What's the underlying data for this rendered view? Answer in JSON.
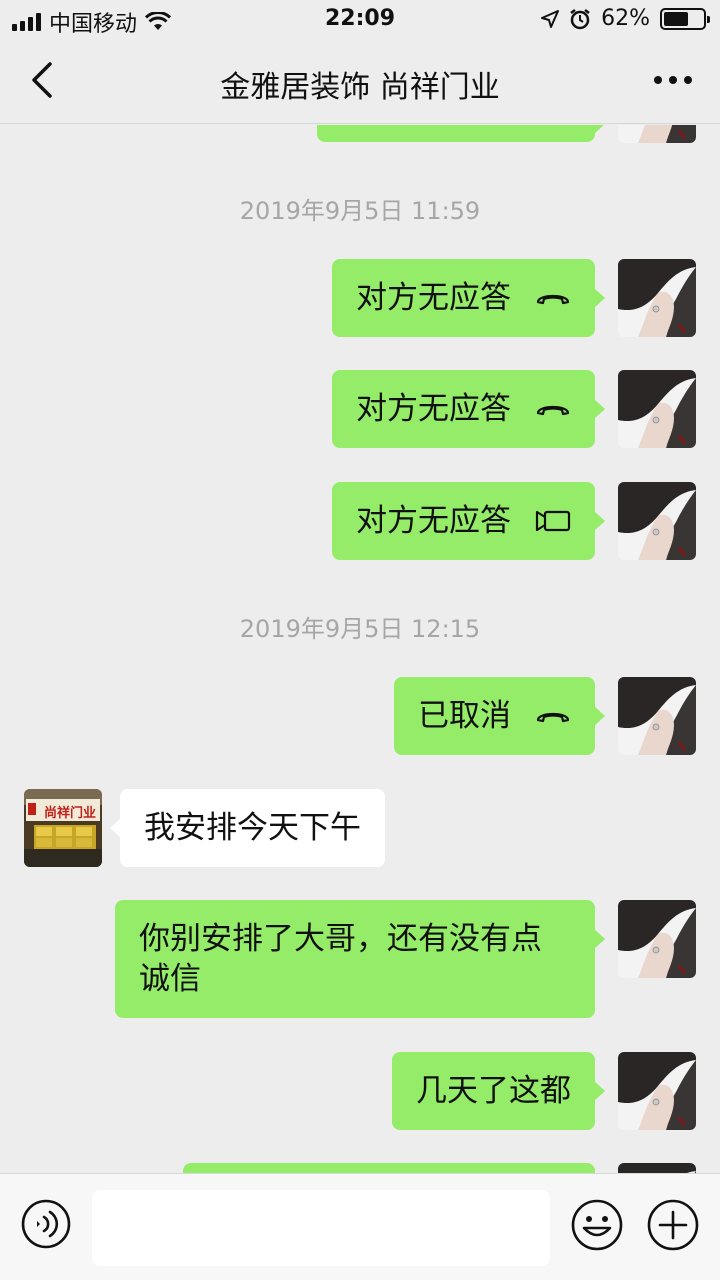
{
  "status_bar": {
    "carrier": "中国移动",
    "time": "22:09",
    "battery": "62%",
    "battery_level": 0.62,
    "icons": [
      "signal-icon",
      "wifi-icon",
      "location-icon",
      "alarm-icon",
      "battery-icon"
    ]
  },
  "header": {
    "title": "金雅居装饰  尚祥门业",
    "back_icon": "chevron-left-icon",
    "more_icon": "more-icon"
  },
  "messages": [
    {
      "type": "bubble-edge",
      "side": "mine"
    },
    {
      "type": "time",
      "text": "2019年9月5日 11:59"
    },
    {
      "type": "call",
      "side": "mine",
      "text": "对方无应答",
      "icon": "phone-hangup-icon"
    },
    {
      "type": "call",
      "side": "mine",
      "text": "对方无应答",
      "icon": "phone-hangup-icon"
    },
    {
      "type": "call",
      "side": "mine",
      "text": "对方无应答",
      "icon": "video-call-icon"
    },
    {
      "type": "time",
      "text": "2019年9月5日 12:15"
    },
    {
      "type": "call",
      "side": "mine",
      "text": "已取消",
      "icon": "phone-hangup-icon"
    },
    {
      "type": "text",
      "side": "theirs",
      "text": "我安排今天下午"
    },
    {
      "type": "text",
      "side": "mine",
      "text": "你别安排了大哥，还有没有点诚信"
    },
    {
      "type": "text",
      "side": "mine",
      "text": "几天了这都"
    }
  ],
  "contact_avatar": {
    "sign_text": "尚祥门业"
  },
  "input_bar": {
    "placeholder": "",
    "icons": [
      "voice-icon",
      "emoji-icon",
      "plus-icon"
    ]
  }
}
